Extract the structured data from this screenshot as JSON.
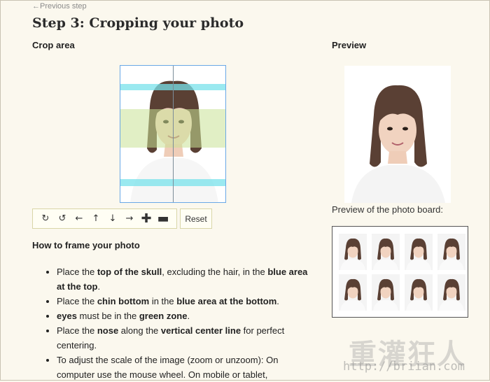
{
  "nav": {
    "previous_step": "←Previous step"
  },
  "page": {
    "title": "Step 3: Cropping your photo"
  },
  "crop": {
    "title": "Crop area"
  },
  "preview": {
    "title": "Preview",
    "board_label": "Preview of the photo board:"
  },
  "toolbar": {
    "buttons": [
      {
        "name": "rotate-right",
        "glyph": "↻"
      },
      {
        "name": "rotate-left",
        "glyph": "↺"
      },
      {
        "name": "move-left",
        "glyph": "←"
      },
      {
        "name": "move-up",
        "glyph": "↑"
      },
      {
        "name": "move-down",
        "glyph": "↓"
      },
      {
        "name": "move-right",
        "glyph": "→"
      },
      {
        "name": "zoom-in",
        "glyph": "✚"
      },
      {
        "name": "zoom-out",
        "glyph": "▬"
      }
    ],
    "reset_label": "Reset"
  },
  "instructions": {
    "title": "How to frame your photo",
    "items": [
      [
        "Place the ",
        {
          "b": "top of the skull"
        },
        ", excluding the hair, in the ",
        {
          "b": "blue area at the top"
        },
        "."
      ],
      [
        "Place the ",
        {
          "b": "chin bottom"
        },
        " in the ",
        {
          "b": "blue area at the bottom"
        },
        "."
      ],
      [
        {
          "b": "eyes"
        },
        " must be in the ",
        {
          "b": "green zone"
        },
        "."
      ],
      [
        "Place the ",
        {
          "b": "nose"
        },
        " along the ",
        {
          "b": "vertical center line"
        },
        " for perfect centering."
      ],
      [
        "To adjust the scale of the image (zoom or unzoom): On computer use the mouse wheel. On mobile or tablet,"
      ]
    ]
  },
  "watermark": {
    "text": "重灌狂人",
    "url": "http://briian.com"
  },
  "colors": {
    "blue_band": "#78e1eb",
    "green_band": "#c8e196",
    "crop_border": "#6aa8e6"
  }
}
